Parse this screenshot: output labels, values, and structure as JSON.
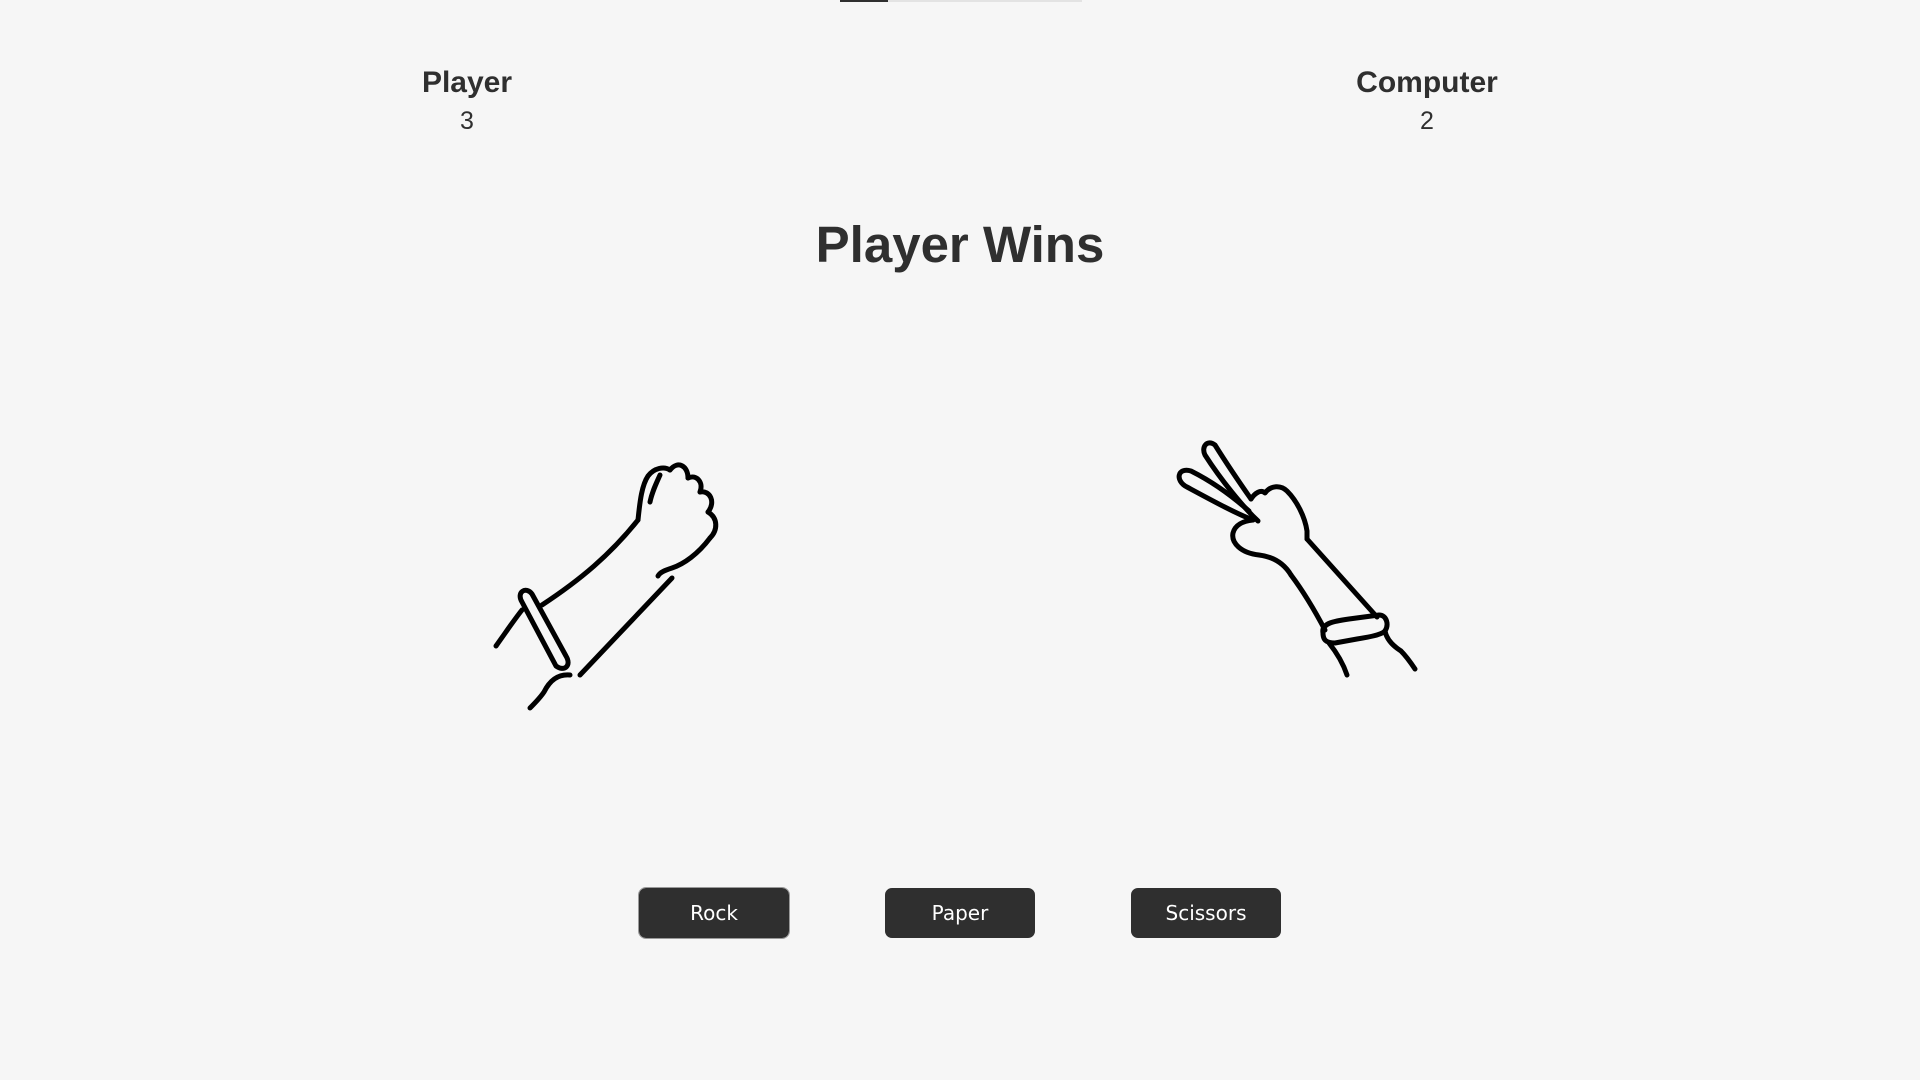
{
  "scoreboard": {
    "player": {
      "label": "Player",
      "score": "3"
    },
    "computer": {
      "label": "Computer",
      "score": "2"
    }
  },
  "result": {
    "text": "Player Wins"
  },
  "hands": {
    "player": {
      "icon": "rock-fist-icon"
    },
    "computer": {
      "icon": "scissors-hand-icon"
    }
  },
  "choices": [
    {
      "label": "Rock"
    },
    {
      "label": "Paper"
    },
    {
      "label": "Scissors"
    }
  ],
  "colors": {
    "background": "#f6f6f6",
    "text": "#2f2f2f",
    "button": "#2f2f2f",
    "button_text": "#ffffff"
  }
}
